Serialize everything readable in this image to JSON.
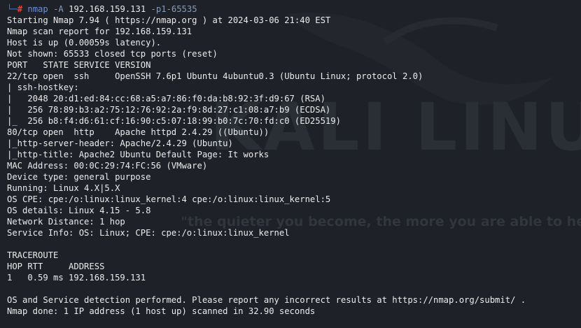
{
  "watermark": {
    "logo": "KALI LINUX",
    "quote": "\"the quieter you become, the more you are able to hear\""
  },
  "prompt": {
    "branch": "└─",
    "hash": "#",
    "command": "nmap",
    "host": "192.168.159.131",
    "ports": "-p1-65535",
    "flag": "-A"
  },
  "output": {
    "lines": [
      "Starting Nmap 7.94 ( https://nmap.org ) at 2024-03-06 21:40 EST",
      "Nmap scan report for 192.168.159.131",
      "Host is up (0.00059s latency).",
      "Not shown: 65533 closed tcp ports (reset)",
      "PORT   STATE SERVICE VERSION",
      "22/tcp open  ssh     OpenSSH 7.6p1 Ubuntu 4ubuntu0.3 (Ubuntu Linux; protocol 2.0)",
      "| ssh-hostkey: ",
      "|   2048 20:d1:ed:84:cc:68:a5:a7:86:f0:da:b8:92:3f:d9:67 (RSA)",
      "|   256 78:89:b3:a2:75:12:76:92:2a:f9:8d:27:c1:08:a7:b9 (ECDSA)",
      "|_  256 b8:f4:d6:61:cf:16:90:c5:07:18:99:b0:7c:70:fd:c0 (ED25519)",
      "80/tcp open  http    Apache httpd 2.4.29 ((Ubuntu))",
      "|_http-server-header: Apache/2.4.29 (Ubuntu)",
      "|_http-title: Apache2 Ubuntu Default Page: It works",
      "MAC Address: 00:0C:29:74:FC:56 (VMware)",
      "Device type: general purpose",
      "Running: Linux 4.X|5.X",
      "OS CPE: cpe:/o:linux:linux_kernel:4 cpe:/o:linux:linux_kernel:5",
      "OS details: Linux 4.15 - 5.8",
      "Network Distance: 1 hop",
      "Service Info: OS: Linux; CPE: cpe:/o:linux:linux_kernel",
      "",
      "TRACEROUTE",
      "HOP RTT     ADDRESS",
      "1   0.59 ms 192.168.159.131",
      "",
      "OS and Service detection performed. Please report any incorrect results at https://nmap.org/submit/ .",
      "Nmap done: 1 IP address (1 host up) scanned in 32.90 seconds"
    ]
  },
  "colors": {
    "background": "#1e2127",
    "text": "#ececec",
    "prompt_branch": "#3f7ad6",
    "prompt_hash": "#e0443a",
    "command": "#6a8fe0"
  }
}
